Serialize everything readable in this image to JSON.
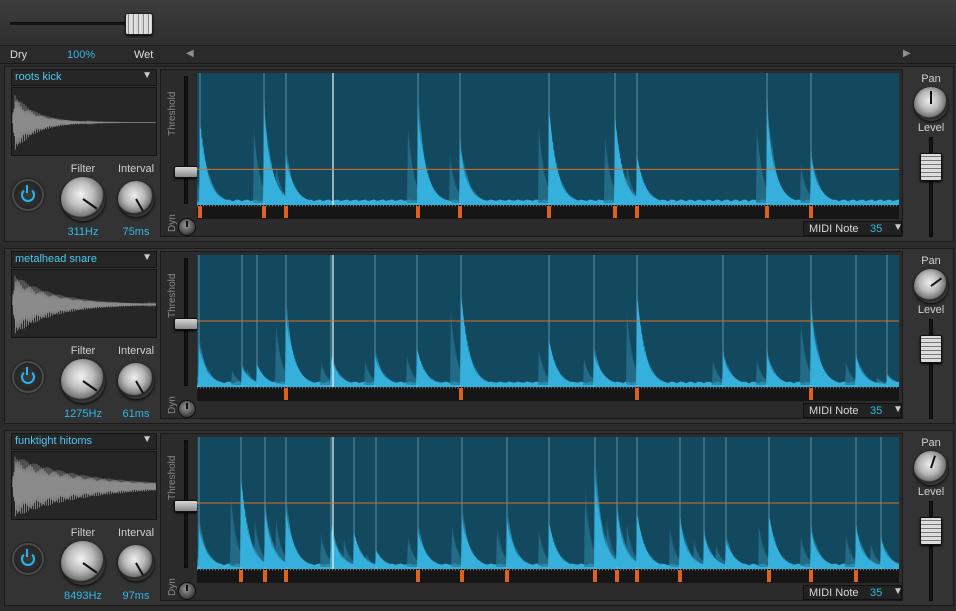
{
  "mixer": {
    "dry_label": "Dry",
    "value": "100%",
    "wet_label": "Wet",
    "scroll_left": "◀",
    "scroll_right": "▶"
  },
  "colors": {
    "accent": "#2fb9e8",
    "display_bg": "#13495f",
    "wave": "#35b0dd",
    "threshold": "#d9702a",
    "trigger": "#e0601e"
  },
  "tracks": [
    {
      "sample": "roots kick",
      "filter_label": "Filter",
      "filter_value": "311Hz",
      "interval_label": "Interval",
      "interval_value": "75ms",
      "threshold_label": "Threshold",
      "dyn_label": "Dyn",
      "midi_label": "MIDI Note",
      "midi_value": "35",
      "pan_label": "Pan",
      "level_label": "Level",
      "hits": [
        [
          3,
          0.77
        ],
        [
          67,
          0.9
        ],
        [
          89,
          0.46
        ],
        [
          221,
          0.93
        ],
        [
          263,
          0.56
        ],
        [
          352,
          0.9
        ],
        [
          418,
          0.82
        ],
        [
          440,
          0.45
        ],
        [
          570,
          0.9
        ],
        [
          614,
          0.45
        ]
      ],
      "triggers": [
        3,
        67,
        89,
        221,
        263,
        352,
        418,
        440,
        570,
        614
      ],
      "threshold": 0.27,
      "dyn": 0.0,
      "pan": 0.0,
      "level": 0.7,
      "sample_decay": "short"
    },
    {
      "sample": "metalhead snare",
      "filter_label": "Filter",
      "filter_value": "1275Hz",
      "interval_label": "Interval",
      "interval_value": "61ms",
      "threshold_label": "Threshold",
      "dyn_label": "Dyn",
      "midi_label": "MIDI Note",
      "midi_value": "35",
      "pan_label": "Pan",
      "level_label": "Level",
      "hits": [
        [
          2,
          0.4
        ],
        [
          45,
          0.18
        ],
        [
          60,
          0.2
        ],
        [
          89,
          0.73
        ],
        [
          134,
          0.28
        ],
        [
          178,
          0.3
        ],
        [
          220,
          0.35
        ],
        [
          264,
          0.87
        ],
        [
          352,
          0.43
        ],
        [
          397,
          0.33
        ],
        [
          440,
          0.87
        ],
        [
          526,
          0.3
        ],
        [
          570,
          0.3
        ],
        [
          614,
          0.73
        ],
        [
          659,
          0.28
        ],
        [
          690,
          0.1
        ]
      ],
      "triggers": [
        89,
        264,
        440,
        614
      ],
      "threshold": 0.5,
      "dyn": 0.0,
      "pan": 0.15,
      "level": 0.7,
      "sample_decay": "medium"
    },
    {
      "sample": "funktight hitoms",
      "filter_label": "Filter",
      "filter_value": "8493Hz",
      "interval_label": "Interval",
      "interval_value": "97ms",
      "threshold_label": "Threshold",
      "dyn_label": "Dyn",
      "midi_label": "MIDI Note",
      "midi_value": "35",
      "pan_label": "Pan",
      "level_label": "Level",
      "hits": [
        [
          2,
          0.4
        ],
        [
          44,
          0.85
        ],
        [
          68,
          0.55
        ],
        [
          89,
          0.58
        ],
        [
          134,
          0.4
        ],
        [
          157,
          0.33
        ],
        [
          179,
          0.16
        ],
        [
          221,
          0.37
        ],
        [
          265,
          0.5
        ],
        [
          310,
          0.48
        ],
        [
          352,
          0.43
        ],
        [
          398,
          0.92
        ],
        [
          420,
          0.55
        ],
        [
          440,
          0.52
        ],
        [
          483,
          0.45
        ],
        [
          507,
          0.32
        ],
        [
          529,
          0.27
        ],
        [
          572,
          0.5
        ],
        [
          614,
          0.36
        ],
        [
          659,
          0.38
        ],
        [
          684,
          0.27
        ]
      ],
      "triggers": [
        44,
        68,
        89,
        221,
        265,
        310,
        398,
        420,
        440,
        483,
        572,
        614,
        659
      ],
      "threshold": 0.5,
      "dyn": 0.0,
      "pan": 0.05,
      "level": 0.7,
      "sample_decay": "long"
    }
  ]
}
